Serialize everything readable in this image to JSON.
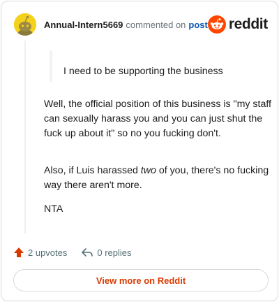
{
  "header": {
    "username": "Annual-Intern5669",
    "commented_text": "commented on",
    "post_link": "post",
    "brand_name": "reddit"
  },
  "comment": {
    "quote": "I need to be supporting the business",
    "paragraph1": "Well, the official position of this business is \"my staff can sexually harass you and you can just shut the fuck up about it\" so no you fucking don't.",
    "paragraph2": {
      "before": "Also, if Luis harassed ",
      "emphasis": "two",
      "after": " of you, there's no fucking way there aren't more."
    },
    "paragraph3": "NTA"
  },
  "actions": {
    "upvotes": "2 upvotes",
    "replies": "0 replies",
    "upvote_icon": "arrow-up-icon",
    "reply_icon": "reply-arrow-icon"
  },
  "footer": {
    "view_more": "View more on Reddit"
  },
  "colors": {
    "reddit_orange": "#ff4500",
    "upvote_orange": "#d93a00",
    "link_blue": "#0a57b0",
    "avatar_yellow": "#f4d21c"
  }
}
